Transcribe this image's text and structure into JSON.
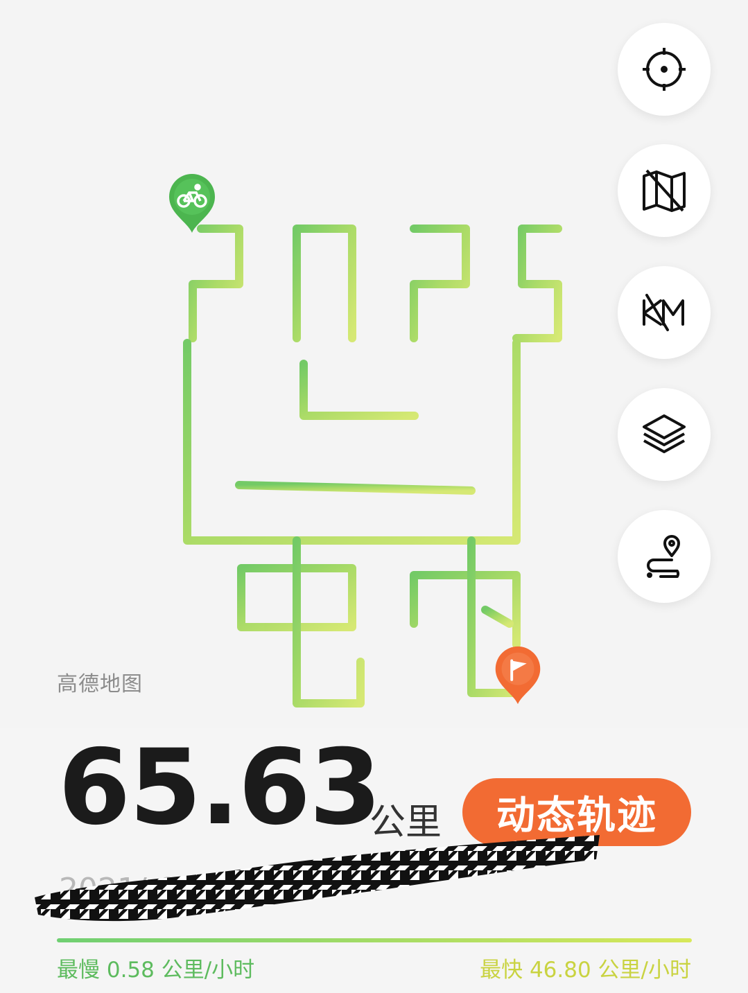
{
  "map": {
    "provider_label": "高德地图",
    "route_color_start": "#6cc85a",
    "route_color_end": "#c5e065"
  },
  "toolbar": {
    "buttons": [
      {
        "icon": "locate-target-icon"
      },
      {
        "icon": "map-off-icon"
      },
      {
        "icon": "km-off-icon"
      },
      {
        "icon": "layers-icon"
      },
      {
        "icon": "route-pin-icon"
      }
    ]
  },
  "pins": {
    "start_icon": "bicycle-icon",
    "start_color": "#4cb54f",
    "end_icon": "flag-icon",
    "end_color": "#f26b33"
  },
  "stats": {
    "distance": "65.63",
    "distance_unit": "公里",
    "dynamic_button_label": "动态轨迹",
    "date_partial": "2021/                    6:05",
    "speed_min_label": "最慢 0.58 公里/小时",
    "speed_max_label": "最快 46.80 公里/小时",
    "accent_color": "#f26b33"
  }
}
